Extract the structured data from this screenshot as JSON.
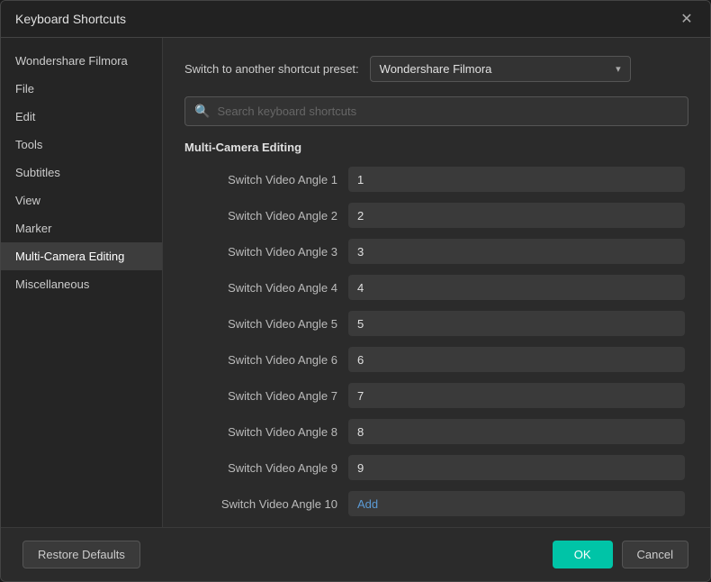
{
  "dialog": {
    "title": "Keyboard Shortcuts"
  },
  "sidebar": {
    "items": [
      {
        "id": "wondershare-filmora",
        "label": "Wondershare Filmora",
        "active": false
      },
      {
        "id": "file",
        "label": "File",
        "active": false
      },
      {
        "id": "edit",
        "label": "Edit",
        "active": false
      },
      {
        "id": "tools",
        "label": "Tools",
        "active": false
      },
      {
        "id": "subtitles",
        "label": "Subtitles",
        "active": false
      },
      {
        "id": "view",
        "label": "View",
        "active": false
      },
      {
        "id": "marker",
        "label": "Marker",
        "active": false
      },
      {
        "id": "multi-camera-editing",
        "label": "Multi-Camera Editing",
        "active": true
      },
      {
        "id": "miscellaneous",
        "label": "Miscellaneous",
        "active": false
      }
    ]
  },
  "preset": {
    "label": "Switch to another shortcut preset:",
    "value": "Wondershare Filmora"
  },
  "search": {
    "placeholder": "Search keyboard shortcuts"
  },
  "section": {
    "title": "Multi-Camera Editing"
  },
  "shortcuts": [
    {
      "name": "Switch Video Angle 1",
      "key": "1",
      "empty": false
    },
    {
      "name": "Switch Video Angle 2",
      "key": "2",
      "empty": false
    },
    {
      "name": "Switch Video Angle 3",
      "key": "3",
      "empty": false
    },
    {
      "name": "Switch Video Angle 4",
      "key": "4",
      "empty": false
    },
    {
      "name": "Switch Video Angle 5",
      "key": "5",
      "empty": false
    },
    {
      "name": "Switch Video Angle 6",
      "key": "6",
      "empty": false
    },
    {
      "name": "Switch Video Angle 7",
      "key": "7",
      "empty": false
    },
    {
      "name": "Switch Video Angle 8",
      "key": "8",
      "empty": false
    },
    {
      "name": "Switch Video Angle 9",
      "key": "9",
      "empty": false
    },
    {
      "name": "Switch Video Angle 10",
      "key": "Add",
      "empty": false
    }
  ],
  "footer": {
    "restore_label": "Restore Defaults",
    "ok_label": "OK",
    "cancel_label": "Cancel"
  }
}
